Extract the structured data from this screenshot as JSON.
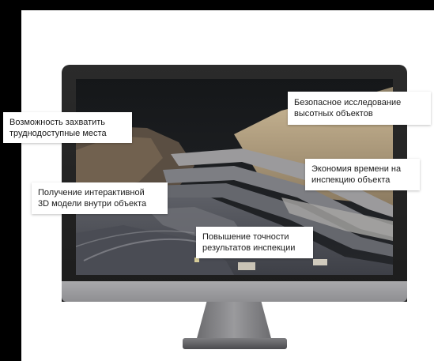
{
  "callouts": {
    "capture": "Возможность захватить\nтруднодоступные места",
    "safe": "Безопасное исследование\nвысотных объектов",
    "time": "Экономия времени на\nинспекцию объекта",
    "model": "Получение интерактивной\n3D модели внутри объекта",
    "accuracy": "Повышение точности\nрезультатов инспекции"
  }
}
